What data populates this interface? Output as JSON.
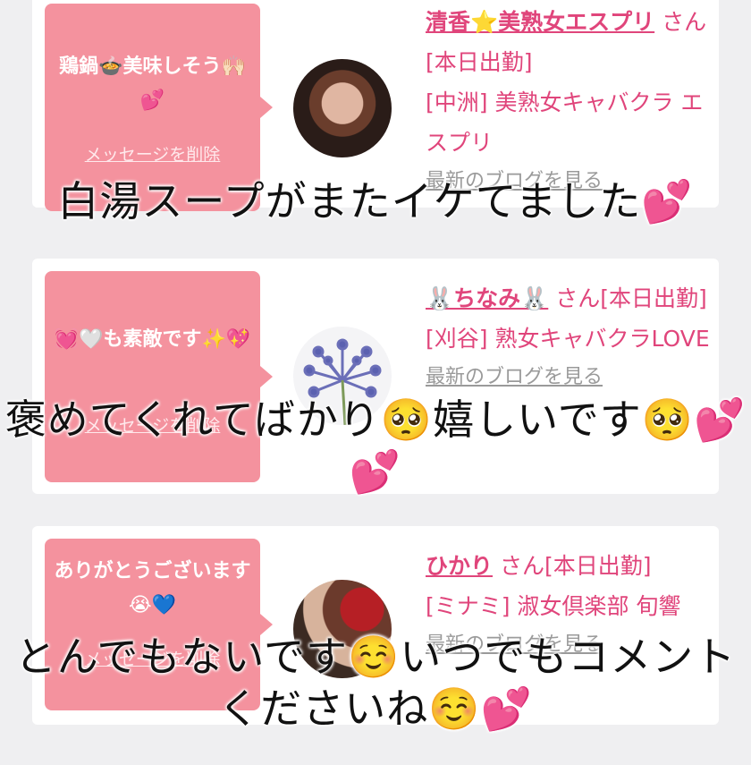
{
  "cards": [
    {
      "message": "鶏鍋🍲美味しそう🙌🏻💕",
      "delete_label": "メッセージを削除",
      "name": "清香⭐️美熟女エスプリ",
      "suffix": "さん[本日出勤]",
      "shop": "[中洲] 美熟女キャバクラ エスプリ",
      "blog_link": "最新のブログを見る",
      "avatar": "woman-portrait"
    },
    {
      "message": "💓🤍も素敵です✨💖",
      "delete_label": "メッセージを削除",
      "name": "🐰ちなみ🐰",
      "suffix": "さん[本日出勤]",
      "shop": "[刈谷] 熟女キャバクラLOVE",
      "blog_link": "最新のブログを見る",
      "avatar": "purple-flower"
    },
    {
      "message": "ありがとうございます😭💙",
      "delete_label": "メッセージを削除",
      "name": "ひかり",
      "suffix": "さん[本日出勤]",
      "shop": "[ミナミ] 淑女倶楽部 旬響",
      "blog_link": "最新のブログを見る",
      "avatar": "woman-red-hair"
    }
  ],
  "captions": [
    "白湯スープがまたイケてました💕",
    "褒めてくれてばかり🥺嬉しいです🥺💕💕",
    "とんでもないです☺️いつでもコメントくださいね☺️💕"
  ],
  "colors": {
    "accent": "#e0457b",
    "bubble": "#f4929e",
    "background": "#efeff1"
  }
}
